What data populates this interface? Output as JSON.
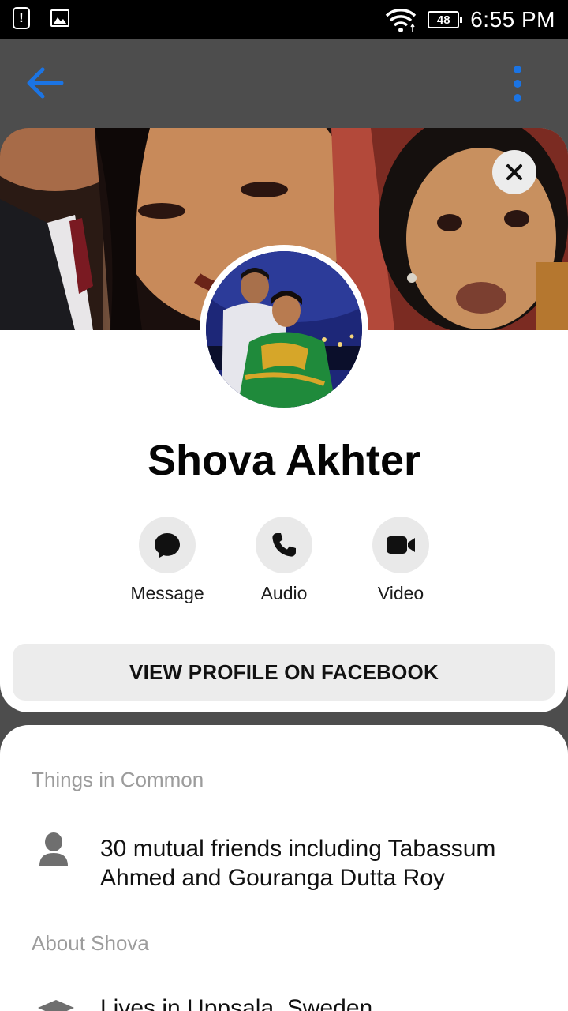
{
  "status_bar": {
    "battery": "48",
    "time": "6:55 PM",
    "icons": [
      "alert-icon",
      "image-icon",
      "wifi-icon",
      "battery-icon"
    ]
  },
  "app_bar": {
    "icons": [
      "back-arrow-icon",
      "more-vert-icon"
    ],
    "accent_color": "#1b74e4"
  },
  "profile": {
    "name": "Shova Akhter",
    "close_icon": "close-icon"
  },
  "actions": [
    {
      "label": "Message",
      "icon": "message-bubble-icon"
    },
    {
      "label": "Audio",
      "icon": "phone-icon"
    },
    {
      "label": "Video",
      "icon": "video-camera-icon"
    }
  ],
  "view_profile_label": "VIEW PROFILE ON FACEBOOK",
  "things_in_common": {
    "title": "Things in Common",
    "items": [
      {
        "icon": "person-icon",
        "text": "30 mutual friends including Tabassum Ahmed and Gouranga Dutta Roy"
      }
    ]
  },
  "about": {
    "title": "About Shova",
    "items": [
      {
        "icon": "graduation-cap-icon",
        "text": "Lives in Uppsala, Sweden"
      }
    ]
  }
}
